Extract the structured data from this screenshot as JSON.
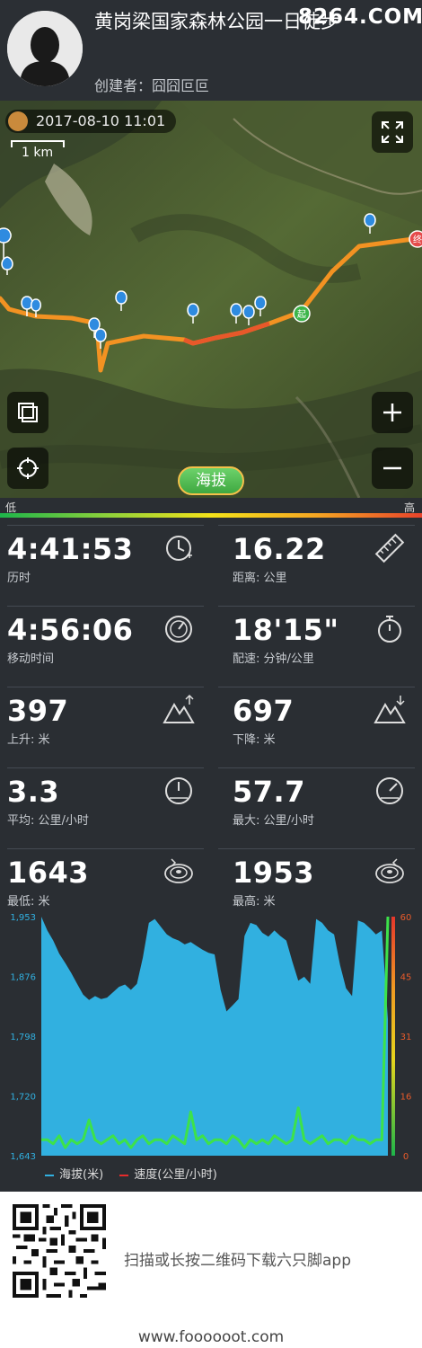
{
  "header": {
    "title": "黄岗梁国家森林公园一日徒步",
    "watermark": "8264.COM",
    "creator": "创建者：囧囧叵叵"
  },
  "map": {
    "date": "2017-08-10 11:01",
    "scale_label": "1 km",
    "altitude_button": "海拔",
    "legend_low": "低",
    "legend_high": "高",
    "start_marker": "起",
    "end_marker": "终",
    "icons": {
      "fullscreen": "fullscreen-icon",
      "layers": "layers-icon",
      "locate": "locate-icon",
      "zoom_in": "plus-icon",
      "zoom_out": "minus-icon"
    }
  },
  "stats": [
    {
      "value": "4:41:53",
      "label": "历时",
      "icon": "clock-icon"
    },
    {
      "value": "16.22",
      "label": "距离: 公里",
      "icon": "ruler-icon"
    },
    {
      "value": "4:56:06",
      "label": "移动时间",
      "icon": "gauge-icon"
    },
    {
      "value": "18'15\"",
      "label": "配速: 分钟/公里",
      "icon": "stopwatch-icon"
    },
    {
      "value": "397",
      "label": "上升: 米",
      "icon": "ascent-icon"
    },
    {
      "value": "697",
      "label": "下降: 米",
      "icon": "descent-icon"
    },
    {
      "value": "3.3",
      "label": "平均: 公里/小时",
      "icon": "speedometer-icon"
    },
    {
      "value": "57.7",
      "label": "最大: 公里/小时",
      "icon": "speedometer-max-icon"
    },
    {
      "value": "1643",
      "label": "最低: 米",
      "icon": "contour-low-icon"
    },
    {
      "value": "1953",
      "label": "最高: 米",
      "icon": "contour-high-icon"
    }
  ],
  "chart_data": {
    "type": "area",
    "title": "",
    "xlabel": "",
    "ylabel": "",
    "ylim": [
      1643,
      1953
    ],
    "y_ticks": [
      "1,953",
      "1,876",
      "1,798",
      "1,720",
      "1,643"
    ],
    "y2lim": [
      0,
      60
    ],
    "y2_ticks": [
      "60",
      "45",
      "31",
      "16",
      "0"
    ],
    "legend_position": "bottom-left",
    "series": [
      {
        "name": "海拔(米)",
        "color": "#31b0e0",
        "axis": "left",
        "values": [
          1953,
          1935,
          1922,
          1905,
          1893,
          1880,
          1866,
          1852,
          1845,
          1850,
          1846,
          1848,
          1855,
          1862,
          1865,
          1858,
          1866,
          1900,
          1945,
          1950,
          1940,
          1930,
          1925,
          1922,
          1917,
          1920,
          1915,
          1910,
          1906,
          1904,
          1858,
          1830,
          1838,
          1846,
          1928,
          1945,
          1942,
          1932,
          1927,
          1935,
          1928,
          1922,
          1895,
          1870,
          1875,
          1866,
          1950,
          1945,
          1935,
          1930,
          1890,
          1860,
          1850,
          1948,
          1945,
          1938,
          1930,
          1935,
          1820
        ]
      },
      {
        "name": "速度(公里/小时)",
        "color": "#e52b2b",
        "axis": "right",
        "values": [
          4,
          4,
          3,
          5,
          2,
          4,
          3,
          4,
          9,
          4,
          3,
          4,
          5,
          3,
          4,
          2,
          4,
          5,
          3,
          4,
          4,
          3,
          5,
          4,
          3,
          11,
          4,
          5,
          3,
          4,
          4,
          3,
          5,
          4,
          2,
          4,
          3,
          4,
          3,
          5,
          4,
          3,
          4,
          12,
          4,
          3,
          4,
          5,
          3,
          4,
          4,
          3,
          5,
          4,
          4,
          3,
          4,
          4,
          60
        ]
      }
    ]
  },
  "footer": {
    "scan_text": "扫描或长按二维码下载六只脚app",
    "url": "www.foooooot.com"
  }
}
